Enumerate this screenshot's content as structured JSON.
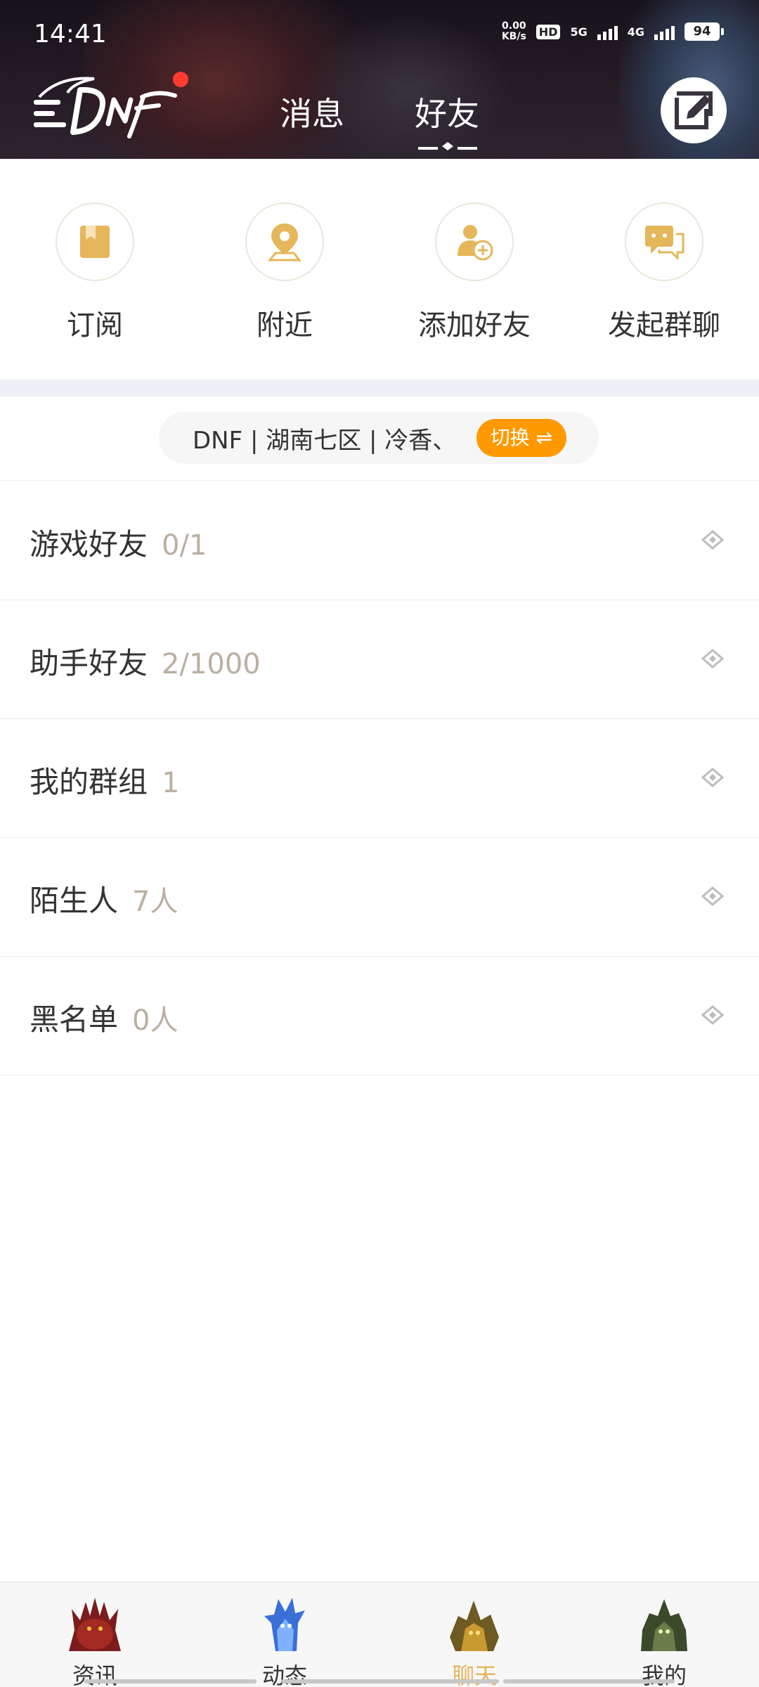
{
  "status_bar": {
    "time": "14:41",
    "net_speed_value": "0.00",
    "net_speed_unit": "KB/s",
    "hd_label": "HD",
    "sim1_label": "5G",
    "sim2_label": "4G",
    "battery": "94"
  },
  "header": {
    "tabs": [
      {
        "label": "消息",
        "active": false
      },
      {
        "label": "好友",
        "active": true
      }
    ],
    "has_notification_dot": true
  },
  "quick_actions": [
    {
      "label": "订阅",
      "icon": "bookmark-icon"
    },
    {
      "label": "附近",
      "icon": "location-pin-icon"
    },
    {
      "label": "添加好友",
      "icon": "add-friend-icon"
    },
    {
      "label": "发起群聊",
      "icon": "group-chat-icon"
    }
  ],
  "server": {
    "text": "DNF | 湖南七区 | 冷香、",
    "switch_label": "切换 ⇌"
  },
  "groups": [
    {
      "name": "游戏好友",
      "count": "0/1"
    },
    {
      "name": "助手好友",
      "count": "2/1000"
    },
    {
      "name": "我的群组",
      "count": "1"
    },
    {
      "name": "陌生人",
      "count": "7人"
    },
    {
      "name": "黑名单",
      "count": "0人"
    }
  ],
  "bottom_nav": [
    {
      "label": "资讯",
      "active": false
    },
    {
      "label": "动态",
      "active": false
    },
    {
      "label": "聊天",
      "active": true
    },
    {
      "label": "我的",
      "active": false
    }
  ],
  "colors": {
    "accent_orange": "#ff9900",
    "gold": "#e5b65a",
    "count_gray": "#b9b0a2"
  }
}
